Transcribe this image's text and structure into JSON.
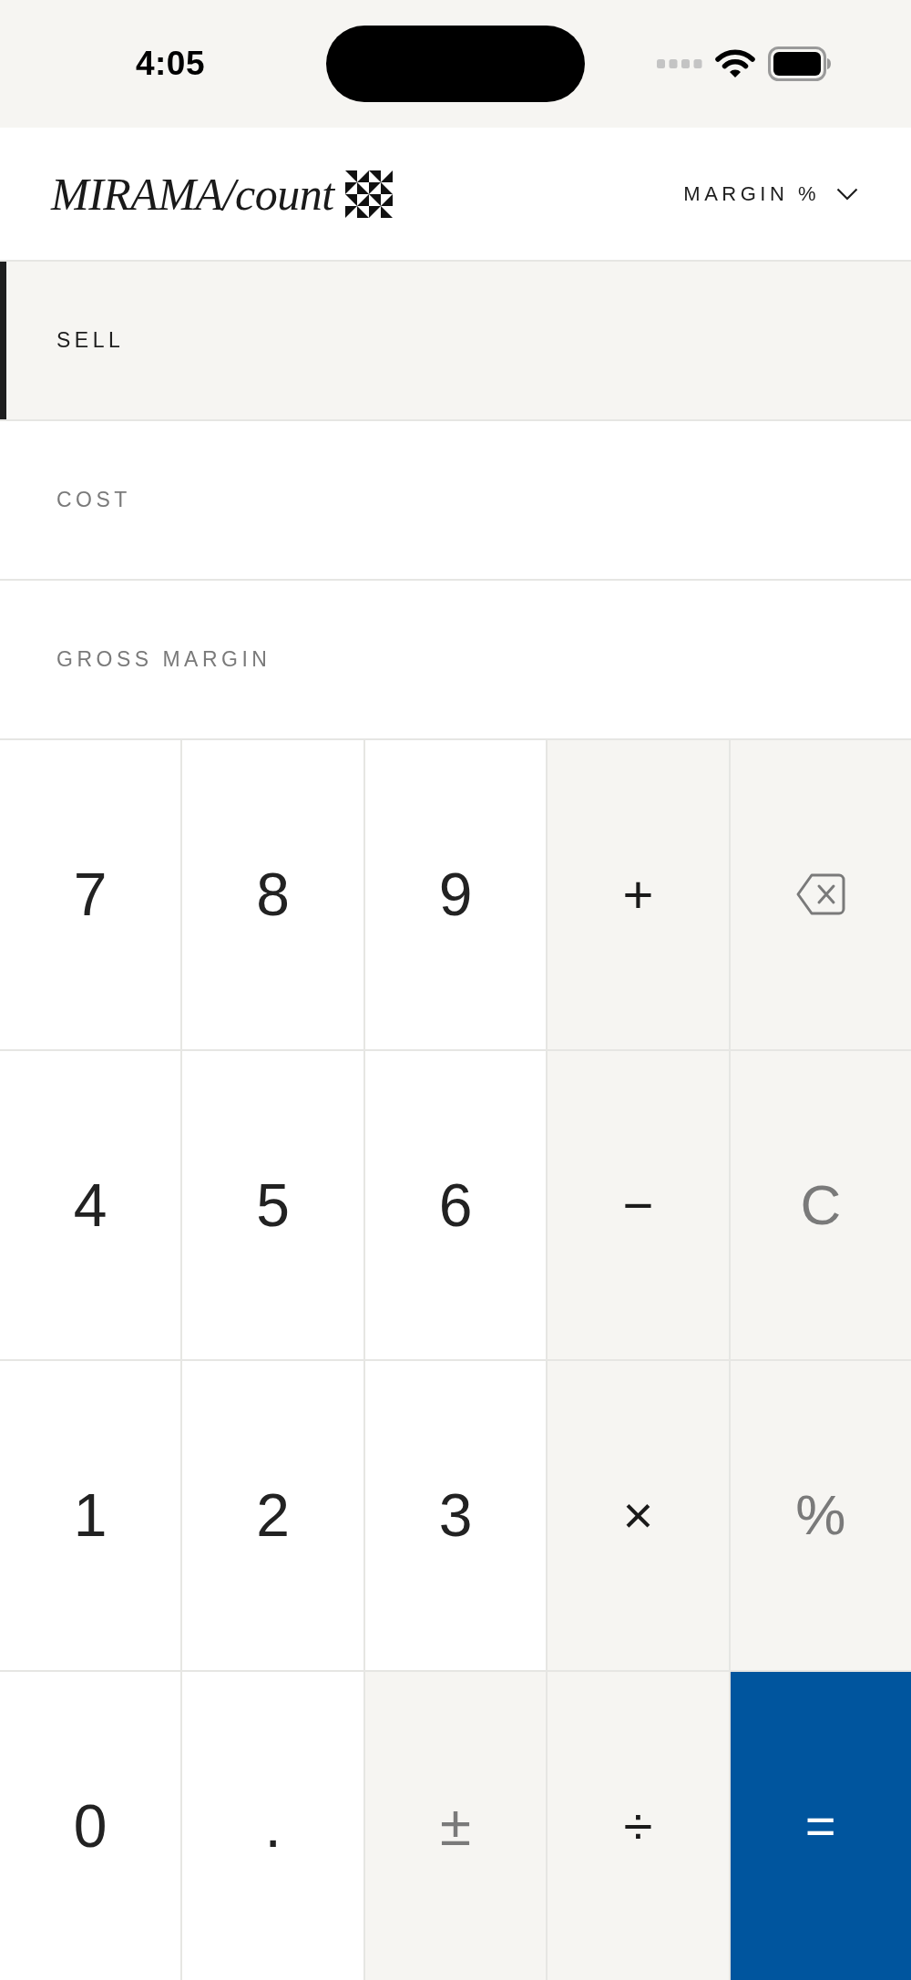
{
  "status_bar": {
    "time": "4:05"
  },
  "header": {
    "logo": "MIRAMA/count",
    "mode_selector": {
      "label": "MARGIN %"
    }
  },
  "fields": [
    {
      "label": "SELL",
      "selected": true
    },
    {
      "label": "COST",
      "selected": false
    },
    {
      "label": "GROSS MARGIN",
      "selected": false
    }
  ],
  "keypad": {
    "rows": [
      {
        "keys": [
          {
            "kind": "digit",
            "label": "7"
          },
          {
            "kind": "digit",
            "label": "8"
          },
          {
            "kind": "digit",
            "label": "9"
          },
          {
            "kind": "operator",
            "label": "+"
          },
          {
            "kind": "backspace"
          }
        ]
      },
      {
        "keys": [
          {
            "kind": "digit",
            "label": "4"
          },
          {
            "kind": "digit",
            "label": "5"
          },
          {
            "kind": "digit",
            "label": "6"
          },
          {
            "kind": "operator",
            "label": "−"
          },
          {
            "kind": "function",
            "label": "C"
          }
        ]
      },
      {
        "keys": [
          {
            "kind": "digit",
            "label": "1"
          },
          {
            "kind": "digit",
            "label": "2"
          },
          {
            "kind": "digit",
            "label": "3"
          },
          {
            "kind": "operator",
            "label": "×"
          },
          {
            "kind": "function",
            "label": "%"
          }
        ]
      },
      {
        "keys": [
          {
            "kind": "digit",
            "label": "0"
          },
          {
            "kind": "digit",
            "label": "."
          },
          {
            "kind": "function",
            "label": "±"
          },
          {
            "kind": "operator",
            "label": "÷"
          },
          {
            "kind": "equals",
            "label": "="
          }
        ]
      }
    ]
  }
}
